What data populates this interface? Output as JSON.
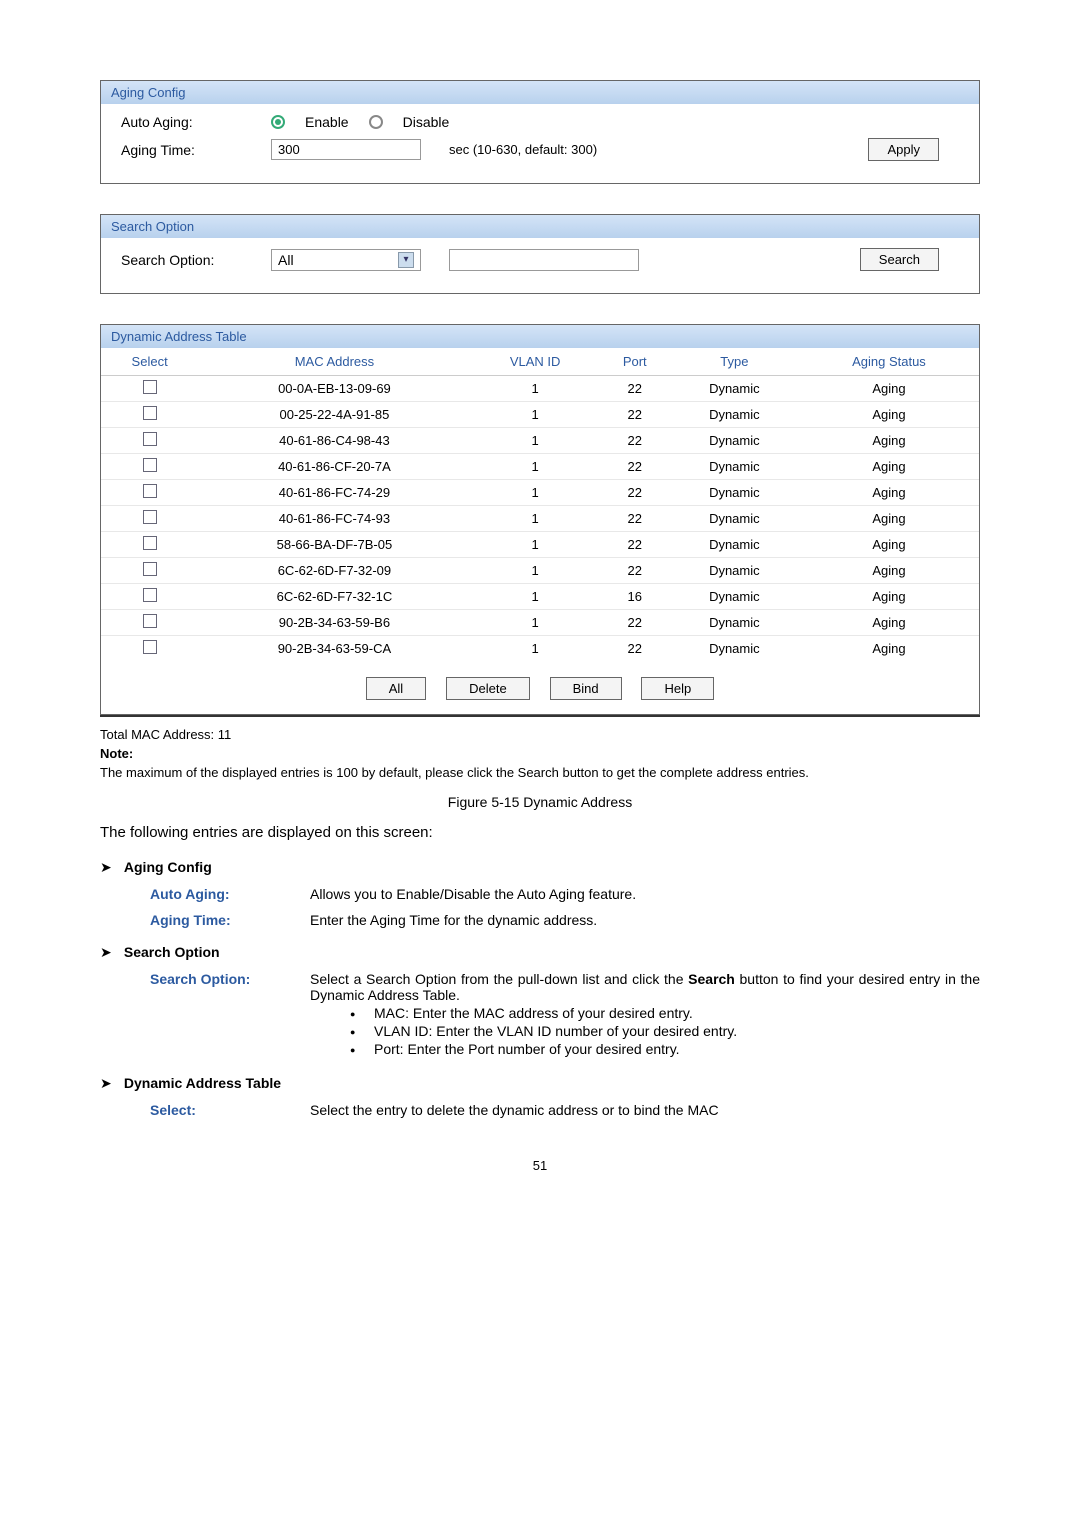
{
  "aging_config": {
    "title": "Aging Config",
    "auto_aging_label": "Auto Aging:",
    "enable_label": "Enable",
    "disable_label": "Disable",
    "aging_time_label": "Aging Time:",
    "aging_time_value": "300",
    "aging_time_hint": "sec (10-630, default: 300)",
    "apply_label": "Apply"
  },
  "search_option": {
    "title": "Search Option",
    "label": "Search Option:",
    "selected": "All",
    "search_label": "Search"
  },
  "dynamic_table": {
    "title": "Dynamic Address Table",
    "headers": {
      "select": "Select",
      "mac": "MAC Address",
      "vlan": "VLAN ID",
      "port": "Port",
      "type": "Type",
      "status": "Aging Status"
    },
    "rows": [
      {
        "mac": "00-0A-EB-13-09-69",
        "vlan": "1",
        "port": "22",
        "type": "Dynamic",
        "status": "Aging"
      },
      {
        "mac": "00-25-22-4A-91-85",
        "vlan": "1",
        "port": "22",
        "type": "Dynamic",
        "status": "Aging"
      },
      {
        "mac": "40-61-86-C4-98-43",
        "vlan": "1",
        "port": "22",
        "type": "Dynamic",
        "status": "Aging"
      },
      {
        "mac": "40-61-86-CF-20-7A",
        "vlan": "1",
        "port": "22",
        "type": "Dynamic",
        "status": "Aging"
      },
      {
        "mac": "40-61-86-FC-74-29",
        "vlan": "1",
        "port": "22",
        "type": "Dynamic",
        "status": "Aging"
      },
      {
        "mac": "40-61-86-FC-74-93",
        "vlan": "1",
        "port": "22",
        "type": "Dynamic",
        "status": "Aging"
      },
      {
        "mac": "58-66-BA-DF-7B-05",
        "vlan": "1",
        "port": "22",
        "type": "Dynamic",
        "status": "Aging"
      },
      {
        "mac": "6C-62-6D-F7-32-09",
        "vlan": "1",
        "port": "22",
        "type": "Dynamic",
        "status": "Aging"
      },
      {
        "mac": "6C-62-6D-F7-32-1C",
        "vlan": "1",
        "port": "16",
        "type": "Dynamic",
        "status": "Aging"
      },
      {
        "mac": "90-2B-34-63-59-B6",
        "vlan": "1",
        "port": "22",
        "type": "Dynamic",
        "status": "Aging"
      },
      {
        "mac": "90-2B-34-63-59-CA",
        "vlan": "1",
        "port": "22",
        "type": "Dynamic",
        "status": "Aging"
      }
    ],
    "actions": {
      "all": "All",
      "delete": "Delete",
      "bind": "Bind",
      "help": "Help"
    }
  },
  "footer": {
    "total": "Total MAC Address: 11",
    "note_label": "Note:",
    "note_text": "The maximum of the displayed entries is 100 by default, please click the Search button to get the complete address entries.",
    "figure": "Figure 5-15 Dynamic Address"
  },
  "desc_intro": "The following entries are displayed on this screen:",
  "sections": {
    "aging": {
      "title": "Aging Config",
      "auto_aging_label": "Auto Aging:",
      "auto_aging_desc": "Allows you to Enable/Disable the Auto Aging feature.",
      "aging_time_label": "Aging Time:",
      "aging_time_desc": "Enter the Aging Time for the dynamic address."
    },
    "search": {
      "title": "Search Option",
      "label": "Search Option:",
      "desc_1": "Select a Search Option from the pull-down list and click the ",
      "desc_bold": "Search",
      "desc_2": " button to find your desired entry in the Dynamic Address Table.",
      "bullets": {
        "b1": "MAC: Enter the MAC address of your desired entry.",
        "b2": "VLAN ID: Enter the VLAN ID number of your desired entry.",
        "b3": "Port: Enter the Port number of your desired entry."
      }
    },
    "dynamic": {
      "title": "Dynamic Address Table",
      "select_label": "Select:",
      "select_desc": "Select the entry to delete the dynamic address or to bind the MAC"
    }
  },
  "page_number": "51"
}
